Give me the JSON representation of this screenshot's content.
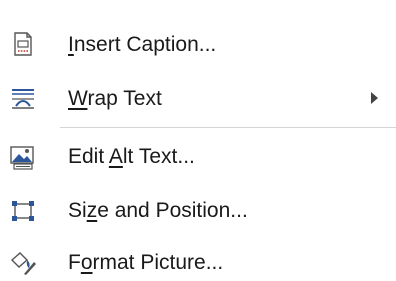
{
  "menu": {
    "items": [
      {
        "icon": "insert-caption-icon",
        "pre": "",
        "ul": "I",
        "post": "nsert Caption...",
        "has_submenu": false
      },
      {
        "icon": "wrap-text-icon",
        "pre": "",
        "ul": "W",
        "post": "rap Text",
        "has_submenu": true
      },
      {
        "icon": "edit-alt-text-icon",
        "pre": "Edit ",
        "ul": "A",
        "post": "lt Text...",
        "has_submenu": false
      },
      {
        "icon": "size-position-icon",
        "pre": "Si",
        "ul": "z",
        "post": "e and Position...",
        "has_submenu": false
      },
      {
        "icon": "format-picture-icon",
        "pre": "F",
        "ul": "o",
        "post": "rmat Picture...",
        "has_submenu": false
      }
    ]
  },
  "colors": {
    "accent_blue": "#2b579a",
    "icon_red": "#c0392b",
    "icon_gray": "#6b6b6b"
  }
}
